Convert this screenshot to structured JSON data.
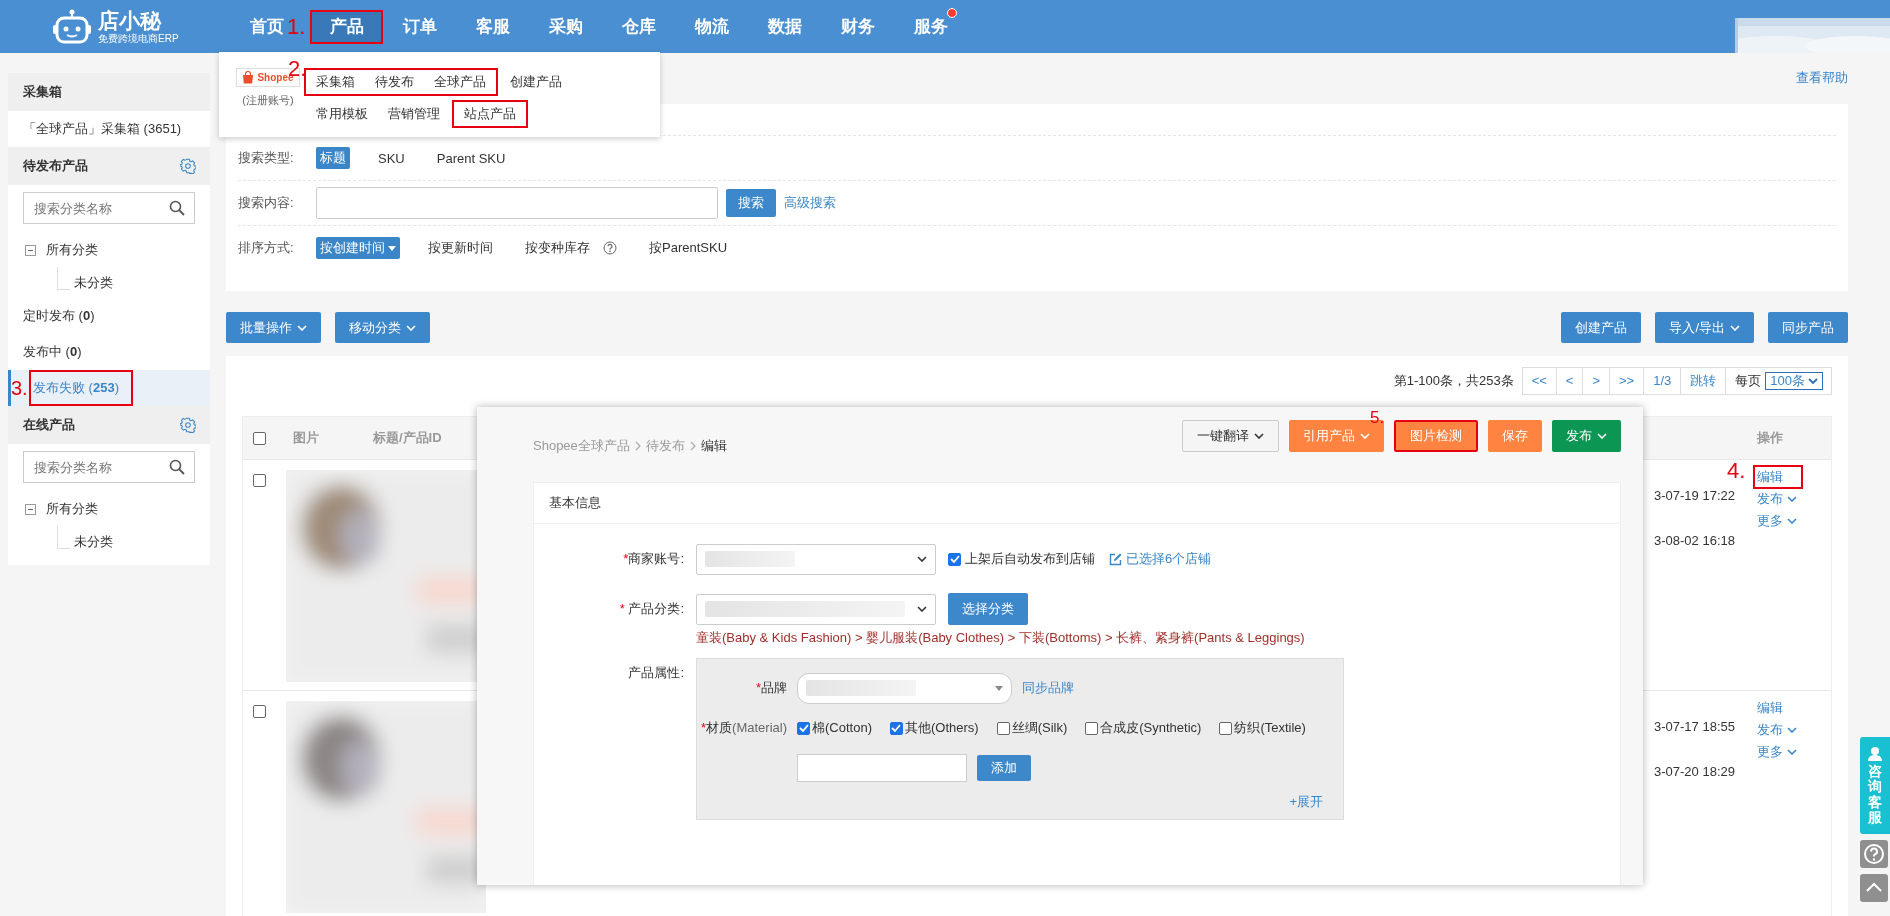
{
  "logo": {
    "name": "店小秘",
    "tagline": "免费跨境电商ERP"
  },
  "nav": [
    {
      "label": "首页",
      "selected": false,
      "highlighted": false,
      "badge": false
    },
    {
      "label": "产品",
      "selected": true,
      "highlighted": true,
      "marker": "1.",
      "badge": false
    },
    {
      "label": "订单",
      "selected": false,
      "highlighted": false,
      "badge": false
    },
    {
      "label": "客服",
      "selected": false,
      "highlighted": false,
      "badge": false
    },
    {
      "label": "采购",
      "selected": false,
      "highlighted": false,
      "badge": false
    },
    {
      "label": "仓库",
      "selected": false,
      "highlighted": false,
      "badge": false
    },
    {
      "label": "物流",
      "selected": false,
      "highlighted": false,
      "badge": false
    },
    {
      "label": "数据",
      "selected": false,
      "highlighted": false,
      "badge": false
    },
    {
      "label": "财务",
      "selected": false,
      "highlighted": false,
      "badge": false
    },
    {
      "label": "服务",
      "selected": false,
      "highlighted": false,
      "badge": true
    }
  ],
  "product_menu": {
    "platform": "Shopee",
    "platform_note": "(注册账号)",
    "marker": "2.",
    "rows": [
      {
        "groups": [
          {
            "highlighted": true,
            "items": [
              "采集箱",
              "待发布",
              "全球产品"
            ]
          },
          {
            "highlighted": false,
            "items": [
              "创建产品"
            ]
          }
        ]
      },
      {
        "groups": [
          {
            "highlighted": false,
            "items": [
              "常用模板",
              "营销管理"
            ]
          },
          {
            "highlighted": true,
            "items": [
              "站点产品"
            ]
          }
        ]
      }
    ]
  },
  "sidebar": [
    {
      "title": "采集箱",
      "gear": false,
      "items": [
        {
          "text": "「全球产品」采集箱 (3651)",
          "selected": false,
          "highlighted": false
        }
      ]
    },
    {
      "title": "待发布产品",
      "gear": true,
      "search_placeholder": "搜索分类名称",
      "tree": {
        "label": "所有分类",
        "expanded": true,
        "children": [
          {
            "label": "未分类"
          }
        ]
      },
      "items": [
        {
          "text": "定时发布 (**0**)",
          "selected": false,
          "highlighted": false
        },
        {
          "text": "发布中 (**0**)",
          "selected": false,
          "highlighted": false
        },
        {
          "text": "发布失败 (**253**)",
          "selected": true,
          "highlighted": true,
          "marker": "3."
        }
      ]
    },
    {
      "title": "在线产品",
      "gear": true,
      "search_placeholder": "搜索分类名称",
      "tree": {
        "label": "所有分类",
        "expanded": true,
        "children": [
          {
            "label": "未分类"
          }
        ]
      }
    }
  ],
  "help_link": "查看帮助",
  "filters": [
    {
      "label": "搜索类型:",
      "kind": "options",
      "options": [
        {
          "label": "标题",
          "selected": true,
          "dropdown": false,
          "help": false
        },
        {
          "label": "SKU",
          "selected": false,
          "dropdown": false,
          "help": false
        },
        {
          "label": "Parent SKU",
          "selected": false,
          "dropdown": false,
          "help": false
        }
      ]
    },
    {
      "label": "搜索内容:",
      "kind": "search",
      "button": "搜索",
      "link": "高级搜索"
    },
    {
      "label": "排序方式:",
      "kind": "options",
      "options": [
        {
          "label": "按创建时间",
          "selected": true,
          "dropdown": true,
          "help": false
        },
        {
          "label": "按更新时间",
          "selected": false,
          "dropdown": false,
          "help": false
        },
        {
          "label": "按变种库存",
          "selected": false,
          "dropdown": false,
          "help": true
        },
        {
          "label": "按ParentSKU",
          "selected": false,
          "dropdown": false,
          "help": false
        }
      ]
    }
  ],
  "toolbar": {
    "left": [
      {
        "label": "批量操作",
        "dropdown": true
      },
      {
        "label": "移动分类",
        "dropdown": true
      }
    ],
    "right": [
      {
        "label": "创建产品",
        "dropdown": false
      },
      {
        "label": "导入/导出",
        "dropdown": true
      },
      {
        "label": "同步产品",
        "dropdown": false
      }
    ]
  },
  "pagination": {
    "summary": "第1-100条，共253条",
    "buttons": [
      "<<",
      "<",
      ">",
      ">>",
      "1/3",
      "跳转"
    ],
    "per_page_label": "每页",
    "per_page": "100条"
  },
  "table": {
    "columns": [
      "图片",
      "标题/产品ID",
      "操作"
    ],
    "all_checked": false,
    "rows": [
      {
        "checked": false,
        "times": [
          "3-07-19 17:22",
          "3-08-02 16:18"
        ],
        "actions": [
          {
            "label": "编辑",
            "dropdown": false,
            "highlighted": true,
            "marker": "4."
          },
          {
            "label": "发布",
            "dropdown": true,
            "highlighted": false
          },
          {
            "label": "更多",
            "dropdown": true,
            "highlighted": false
          }
        ]
      },
      {
        "checked": false,
        "times": [
          "3-07-17 18:55",
          "3-07-20 18:29"
        ],
        "actions": [
          {
            "label": "编辑",
            "dropdown": false,
            "highlighted": false
          },
          {
            "label": "发布",
            "dropdown": true,
            "highlighted": false
          },
          {
            "label": "更多",
            "dropdown": true,
            "highlighted": false
          }
        ]
      }
    ]
  },
  "editor": {
    "breadcrumb": [
      "Shopee全球产品",
      "待发布",
      "编辑"
    ],
    "buttons": [
      {
        "label": "一键翻译",
        "kind": "default",
        "dropdown": true,
        "highlighted": false
      },
      {
        "label": "引用产品",
        "kind": "warning",
        "dropdown": true,
        "highlighted": false
      },
      {
        "label": "图片检测",
        "kind": "warning",
        "dropdown": false,
        "highlighted": true,
        "marker": "5."
      },
      {
        "label": "保存",
        "kind": "warning",
        "dropdown": false,
        "highlighted": false
      },
      {
        "label": "发布",
        "kind": "success",
        "dropdown": true,
        "highlighted": false
      }
    ],
    "section": "基本信息",
    "account": {
      "required": "*",
      "label": "商家账号:",
      "auto_publish": {
        "label": "上架后自动发布到店铺",
        "checked": true
      },
      "stores_link": "已选择6个店铺"
    },
    "category": {
      "required": "*",
      "label": "产品分类:",
      "button": "选择分类",
      "path": "童装(Baby & Kids Fashion) > 婴儿服装(Baby Clothes) > 下装(Bottoms) > 长裤、紧身裤(Pants & Leggings)"
    },
    "attributes": {
      "label": "产品属性:",
      "required": "*",
      "brand_label": "品牌",
      "brand_link": "同步品牌",
      "material_label": "材质",
      "material_hint": "(Material)",
      "materials": [
        {
          "label": "棉(Cotton)",
          "checked": true
        },
        {
          "label": "其他(Others)",
          "checked": true
        },
        {
          "label": "丝绸(Silk)",
          "checked": false
        },
        {
          "label": "合成皮(Synthetic)",
          "checked": false
        },
        {
          "label": "纺织(Textile)",
          "checked": false
        }
      ],
      "add_button": "添加",
      "expand_link": "+展开"
    }
  },
  "float": {
    "consult": "咨询客服"
  }
}
